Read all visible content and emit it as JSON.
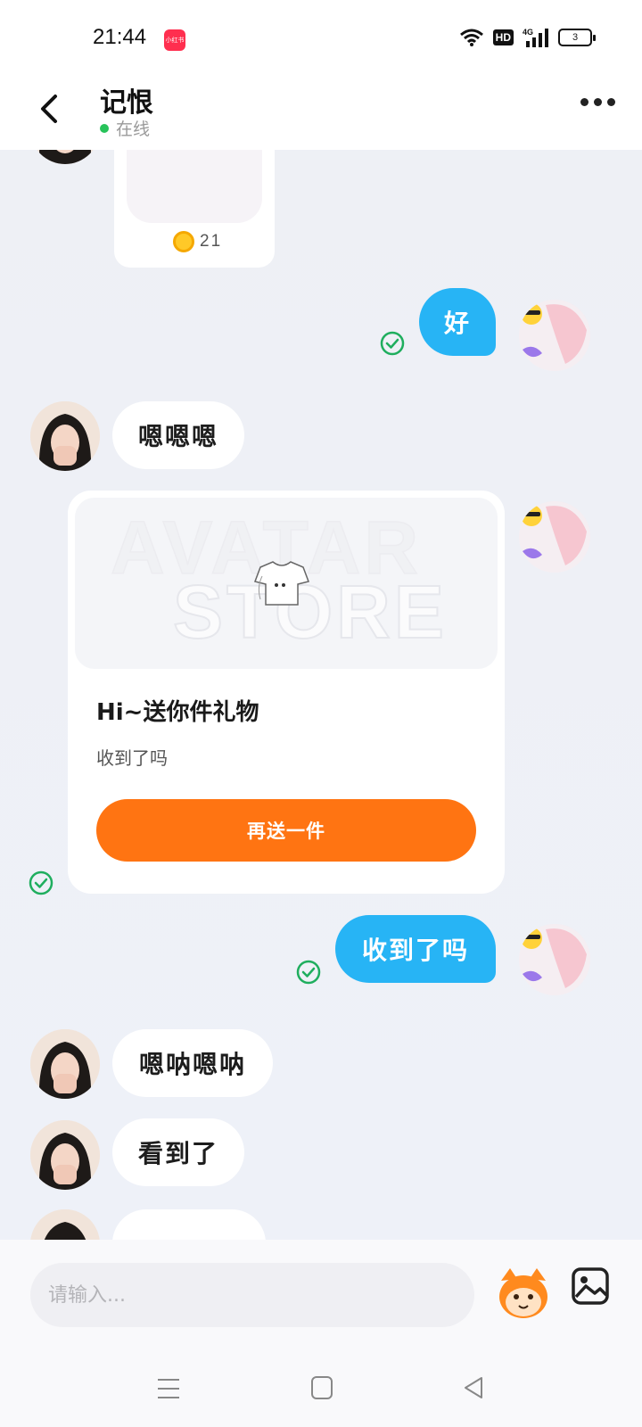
{
  "status_bar": {
    "time": "21:44",
    "app_icon_label": "小红书",
    "hd_badge": "HD",
    "network": "4G",
    "battery": "3"
  },
  "header": {
    "title": "记恨",
    "status": "在线"
  },
  "messages": {
    "coin_value": "21",
    "out_1": "好",
    "in_1": "嗯嗯嗯",
    "gift_card": {
      "banner_word_1": "AVATAR",
      "banner_word_2": "STORE",
      "title": "Hi~送你件礼物",
      "subtitle": "收到了吗",
      "button_label": "再送一件"
    },
    "out_2": "收到了吗",
    "in_2": "嗯呐嗯呐",
    "in_3": "看到了"
  },
  "input": {
    "placeholder": "请输入..."
  },
  "colors": {
    "outgoing_bubble": "#27b4f5",
    "gift_button": "#ff7412",
    "read_check": "#1fae5e",
    "online_dot": "#27c35a"
  }
}
